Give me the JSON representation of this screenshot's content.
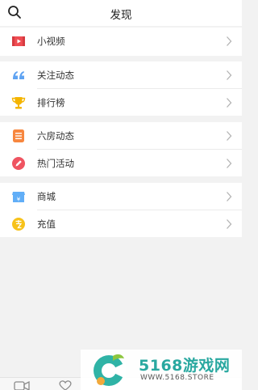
{
  "header": {
    "title": "发现"
  },
  "menu": {
    "videos": "小视频",
    "following": "关注动态",
    "ranking": "排行榜",
    "room_feed": "六房动态",
    "events": "热门活动",
    "mall": "商城",
    "recharge": "充值"
  },
  "icons": {
    "search": "search-icon",
    "videos": "video-icon",
    "following": "quote-icon",
    "ranking": "trophy-icon",
    "room_feed": "list-icon",
    "events": "pencil-icon",
    "mall": "shop-icon",
    "recharge": "recharge-icon",
    "chevron": "chevron-right-icon"
  },
  "colors": {
    "videos": "#ef4c52",
    "following": "#5fa3f2",
    "ranking": "#f4b400",
    "room_feed": "#f7873f",
    "events": "#ef5461",
    "mall": "#61aef7",
    "recharge": "#f7c21a"
  },
  "watermark": {
    "title": "5168游戏网",
    "url": "WWW.5168.STORE"
  }
}
